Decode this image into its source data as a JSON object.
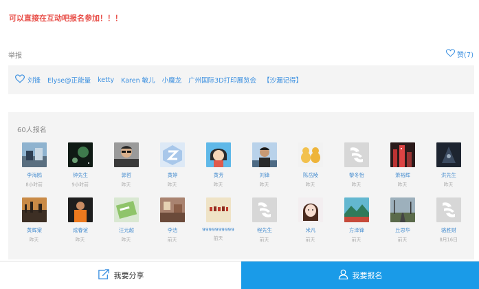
{
  "notice": "可以直接在互动吧报名参加！！！",
  "report_label": "举报",
  "like_label": "赞(7)",
  "likers": [
    "刘锋",
    "Elyse@正能量",
    "ketty",
    "Karen 敏儿",
    "小魔龙",
    "广州国际3D打印展览会",
    "【沙漏记得】"
  ],
  "signup": {
    "title": "60人报名",
    "rows": [
      [
        {
          "name": "李海鸥",
          "time": "8小时前",
          "avatar": "photo-blue"
        },
        {
          "name": "钟先生",
          "time": "9小时前",
          "avatar": "planet"
        },
        {
          "name": "郭哲",
          "time": "昨天",
          "avatar": "person-glasses"
        },
        {
          "name": "黄婷",
          "time": "昨天",
          "avatar": "badge-z"
        },
        {
          "name": "黄芳",
          "time": "昨天",
          "avatar": "cartoon-girl"
        },
        {
          "name": "刘锋",
          "time": "昨天",
          "avatar": "person-sky"
        },
        {
          "name": "陈岳陵",
          "time": "昨天",
          "avatar": "ducks"
        },
        {
          "name": "黎冬怡",
          "time": "昨天",
          "avatar": "default"
        },
        {
          "name": "萧裕辉",
          "time": "昨天",
          "avatar": "city-red"
        },
        {
          "name": "洪先生",
          "time": "昨天",
          "avatar": "dark-game"
        }
      ],
      [
        {
          "name": "黄辉棠",
          "time": "昨天",
          "avatar": "sunset"
        },
        {
          "name": "成春谊",
          "time": "昨天",
          "avatar": "person-orange"
        },
        {
          "name": "汪元超",
          "time": "昨天",
          "avatar": "card-green"
        },
        {
          "name": "李洁",
          "time": "前天",
          "avatar": "room"
        },
        {
          "name": "9999999999",
          "time": "前天",
          "avatar": "calligraphy"
        },
        {
          "name": "程先生",
          "time": "前天",
          "avatar": "default"
        },
        {
          "name": "米凡",
          "time": "前天",
          "avatar": "girl-face"
        },
        {
          "name": "方泽锋",
          "time": "前天",
          "avatar": "landscape"
        },
        {
          "name": "丘思华",
          "time": "前天",
          "avatar": "road"
        },
        {
          "name": "骆胜财",
          "time": "8月16日",
          "avatar": "default"
        }
      ]
    ]
  },
  "bottom": {
    "share_label": "我要分享",
    "join_label": "我要报名"
  },
  "colors": {
    "accent_blue": "#1a9be8",
    "link_blue": "#3a8fe0",
    "notice_red": "#e8504a",
    "panel_gray": "#f4f4f4"
  },
  "icons": {
    "like": "heart-outline-icon",
    "share": "share-icon",
    "join": "user-icon"
  }
}
